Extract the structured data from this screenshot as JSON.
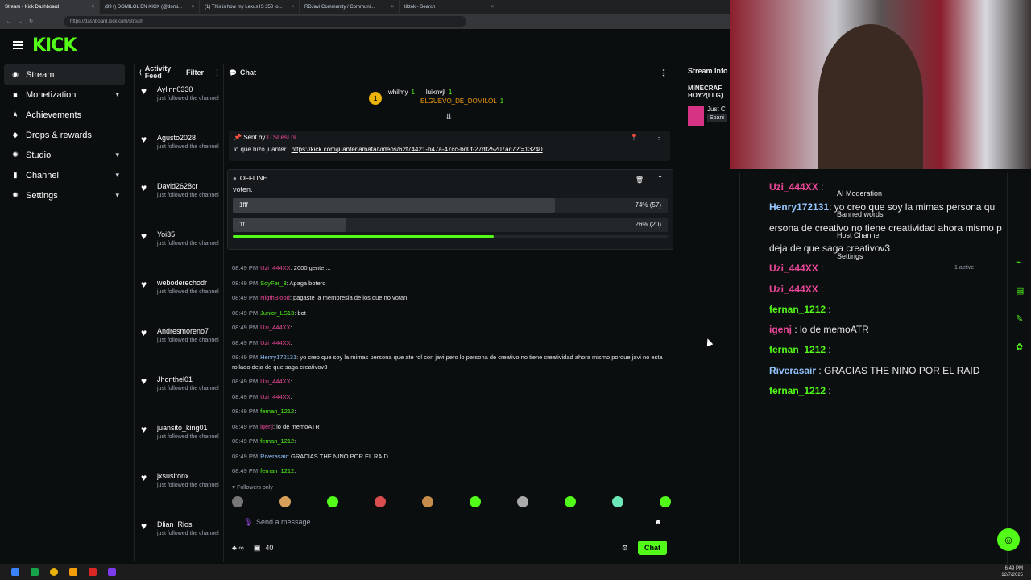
{
  "browser": {
    "tabs": [
      {
        "label": "Stream - Kick Dashboard",
        "active": true
      },
      {
        "label": "(99+) DOMILOL EN KICK (@domi...",
        "active": false
      },
      {
        "label": "(1) This is how my Lexus IS 350 lo...",
        "active": false
      },
      {
        "label": "RDJavi Community / Communi...",
        "active": false
      },
      {
        "label": "tiktok - Search",
        "active": false
      }
    ],
    "url": "https://dashboard.kick.com/stream"
  },
  "brand": {
    "logo": "KICK",
    "accent": "#53fc18"
  },
  "sidebar": {
    "items": [
      {
        "label": "Stream",
        "icon": "broadcast-icon",
        "active": true,
        "chevron": false
      },
      {
        "label": "Monetization",
        "icon": "money-icon",
        "chevron": true
      },
      {
        "label": "Achievements",
        "icon": "trophy-icon",
        "chevron": false
      },
      {
        "label": "Drops & rewards",
        "icon": "gift-icon",
        "chevron": false
      },
      {
        "label": "Studio",
        "icon": "gear-icon",
        "chevron": true
      },
      {
        "label": "Channel",
        "icon": "user-icon",
        "chevron": true
      },
      {
        "label": "Settings",
        "icon": "gear-icon",
        "chevron": true
      }
    ]
  },
  "activity": {
    "title": "Activity Feed",
    "filter": "Filter",
    "items": [
      {
        "name": "Aylinn0330",
        "sub": "just followed the channel"
      },
      {
        "name": "Agusto2028",
        "sub": "just followed the channel"
      },
      {
        "name": "David2628cr",
        "sub": "just followed the channel"
      },
      {
        "name": "Yoi35",
        "sub": "just followed the channel"
      },
      {
        "name": "weboderechodr",
        "sub": "just followed the channel"
      },
      {
        "name": "Andresmoreno7",
        "sub": "just followed the channel"
      },
      {
        "name": "Jhonthel01",
        "sub": "just followed the channel"
      },
      {
        "name": "juansito_king01",
        "sub": "just followed the channel"
      },
      {
        "name": "jxsusitonx",
        "sub": "just followed the channel"
      },
      {
        "name": "Dlian_Rios",
        "sub": "just followed the channel"
      }
    ]
  },
  "chat": {
    "title": "Chat",
    "gifters": [
      {
        "name": "whilmy",
        "count": "1"
      },
      {
        "name": "luixnvjl",
        "count": "1"
      },
      {
        "name": "ELGUEVO_DE_DOMILOL",
        "count": "1"
      }
    ],
    "pinned": {
      "sent_by": "Sent by",
      "sender": "ITSLesLoL",
      "text": "lo que hizo juanfer..",
      "link": "https://kick.com/juanferlamata/videos/62f74421-b47a-47cc-bd0f-27df25207ac7?t=13240"
    },
    "poll": {
      "status": "OFFLINE",
      "question": "voten.",
      "options": [
        {
          "label": "1fff",
          "result": "74% (57)",
          "pct": 74
        },
        {
          "label": "1f",
          "result": "26% (20)",
          "pct": 26
        }
      ],
      "time_progress": 0.6
    },
    "messages": [
      {
        "time": "08:49 PM",
        "user": "Uzi_444XX",
        "color": "#ec4899",
        "text": ": 2000 gente...."
      },
      {
        "time": "08:49 PM",
        "user": "SoyFer_3",
        "color": "#53fc18",
        "text": ": Apaga botero"
      },
      {
        "time": "08:49 PM",
        "user": "NigthBlood",
        "color": "#ec4899",
        "text": ": pagaste la membresia de los que no votan"
      },
      {
        "time": "08:49 PM",
        "user": "Junior_LS13",
        "color": "#53fc18",
        "text": ": bot"
      },
      {
        "time": "08:49 PM",
        "user": "Uzi_444XX",
        "color": "#ec4899",
        "text": ":"
      },
      {
        "time": "08:49 PM",
        "user": "Uzi_444XX",
        "color": "#ec4899",
        "text": ":"
      },
      {
        "time": "08:49 PM",
        "user": "Henry172131",
        "color": "#93c5fd",
        "text": ": yo creo que soy la mimas persona que ate rol con javi pero lo persona de creativo no tiene creatividad ahora mismo porque javi no esta rollado deja de que saga creativov3",
        "wrap": true
      },
      {
        "time": "08:49 PM",
        "user": "Uzi_444XX",
        "color": "#ec4899",
        "text": ":"
      },
      {
        "time": "08:49 PM",
        "user": "Uzi_444XX",
        "color": "#ec4899",
        "text": ":"
      },
      {
        "time": "08:49 PM",
        "user": "fernan_1212",
        "color": "#53fc18",
        "text": ":"
      },
      {
        "time": "08:49 PM",
        "user": "igenj",
        "color": "#ec4899",
        "text": ": lo de memoATR"
      },
      {
        "time": "08:49 PM",
        "user": "fernan_1212",
        "color": "#53fc18",
        "text": ":"
      },
      {
        "time": "08:49 PM",
        "user": "Riverasair",
        "color": "#93c5fd",
        "text": ": GRACIAS THE NINO POR EL RAID"
      },
      {
        "time": "08:49 PM",
        "user": "fernan_1212",
        "color": "#53fc18",
        "text": ":"
      }
    ],
    "mode": "Followers only",
    "placeholder": "Send a message",
    "points": "40",
    "send_label": "Chat"
  },
  "stream_info": {
    "title": "Stream Info",
    "stream_title": "MINECRAF HOY?(LLG)",
    "category": "Just C",
    "lang": "Spani"
  },
  "overlay": {
    "menu": [
      "AI Moderation",
      "Banned words",
      "Host Channel",
      "Settings"
    ],
    "active": "1 active",
    "messages": [
      {
        "user": "Uzi_444XX",
        "color": "#ec4899",
        "text": " :"
      },
      {
        "user": "Henry172131",
        "color": "#93c5fd",
        "text": ": yo creo que soy la mimas persona qu"
      },
      {
        "user": "",
        "color": "#fff",
        "text": "ersona de creativo no tiene creatividad ahora mismo p"
      },
      {
        "user": "",
        "color": "#fff",
        "text": "deja de que saga creativov3"
      },
      {
        "user": "Uzi_444XX",
        "color": "#ec4899",
        "text": " :"
      },
      {
        "user": "Uzi_444XX",
        "color": "#ec4899",
        "text": " :"
      },
      {
        "user": "fernan_1212",
        "color": "#53fc18",
        "text": " :"
      },
      {
        "user": "igenj",
        "color": "#ec4899",
        "text": " : lo de memoATR"
      },
      {
        "user": "fernan_1212",
        "color": "#53fc18",
        "text": " :"
      },
      {
        "user": "Riverasair",
        "color": "#93c5fd",
        "text": " : GRACIAS THE NINO POR EL RAID"
      },
      {
        "user": "fernan_1212",
        "color": "#53fc18",
        "text": " :"
      }
    ]
  },
  "taskbar": {
    "time": "6:49 PM",
    "date": "12/7/2025"
  }
}
